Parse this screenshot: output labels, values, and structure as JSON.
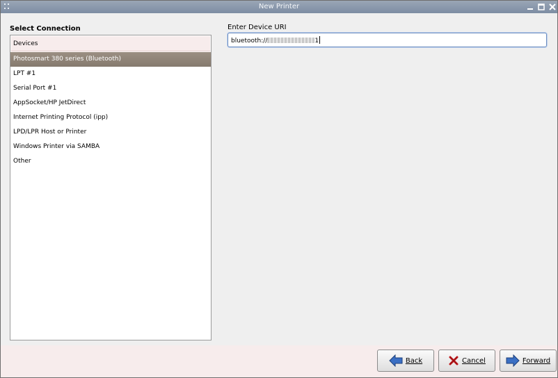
{
  "window": {
    "title": "New Printer"
  },
  "connection": {
    "heading": "Select Connection",
    "header": "Devices",
    "items": [
      {
        "label": "Photosmart 380 series (Bluetooth)",
        "selected": true
      },
      {
        "label": "LPT #1",
        "selected": false
      },
      {
        "label": "Serial Port #1",
        "selected": false
      },
      {
        "label": "AppSocket/HP JetDirect",
        "selected": false
      },
      {
        "label": "Internet Printing Protocol (ipp)",
        "selected": false
      },
      {
        "label": "LPD/LPR Host or Printer",
        "selected": false
      },
      {
        "label": "Windows Printer via SAMBA",
        "selected": false
      },
      {
        "label": "Other",
        "selected": false
      }
    ]
  },
  "uri": {
    "label": "Enter Device URI",
    "value_prefix": "bluetooth://",
    "value_suffix": "1"
  },
  "buttons": {
    "back": {
      "label": "Back",
      "icon": "arrow-left-icon"
    },
    "cancel": {
      "label": "Cancel",
      "icon": "cancel-x-icon"
    },
    "forward": {
      "label": "Forward",
      "icon": "arrow-right-icon"
    }
  },
  "colors": {
    "selection": "#8f8478",
    "accent_blue": "#3a6fc4",
    "cancel_red": "#c0171a"
  }
}
